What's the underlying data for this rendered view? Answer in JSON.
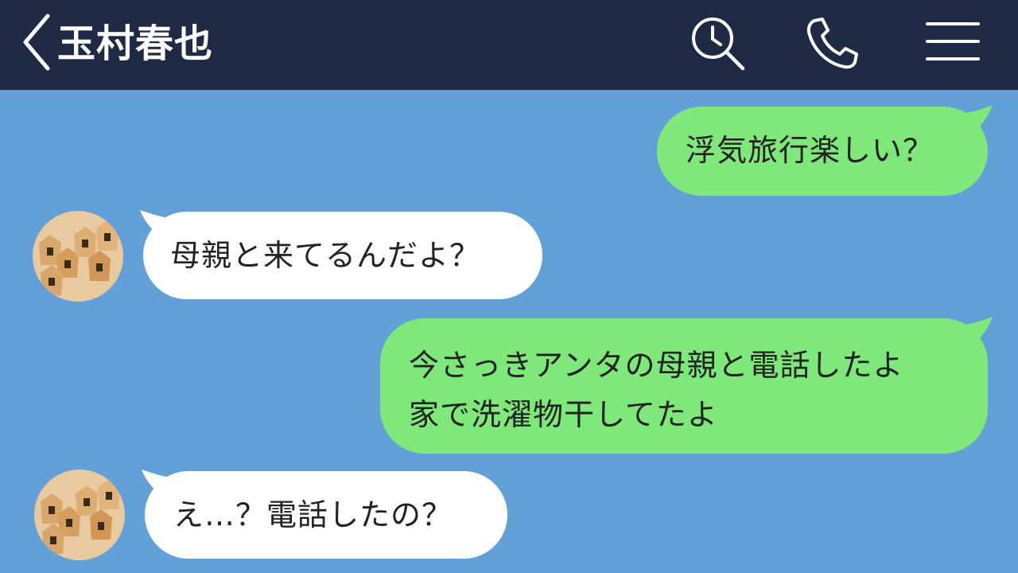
{
  "header": {
    "title": "玉村春也",
    "icons": [
      "back-chevron-icon",
      "search-history-icon",
      "phone-icon",
      "menu-icon"
    ]
  },
  "colors": {
    "header_bg": "#1f2a45",
    "chat_bg": "#64a0d8",
    "sent_bubble": "#7ee87a",
    "received_bubble": "#ffffff"
  },
  "messages": [
    {
      "side": "sent",
      "lines": [
        "浮気旅行楽しい？"
      ]
    },
    {
      "side": "received",
      "lines": [
        "母親と来てるんだよ？"
      ]
    },
    {
      "side": "sent",
      "lines": [
        "今さっきアンタの母親と電話したよ",
        "家で洗濯物干してたよ"
      ]
    },
    {
      "side": "received",
      "lines": [
        "え…？電話したの？"
      ]
    }
  ]
}
